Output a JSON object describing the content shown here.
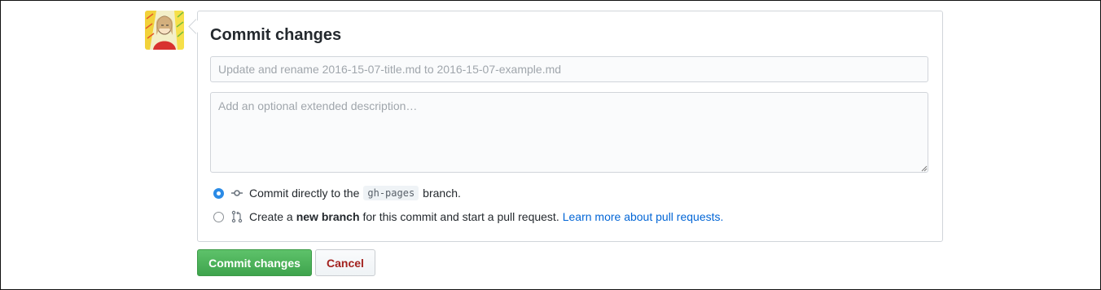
{
  "commit_form": {
    "title": "Commit changes",
    "summary_placeholder": "Update and rename 2016-15-07-title.md to 2016-15-07-example.md",
    "summary_value": "",
    "description_placeholder": "Add an optional extended description…",
    "description_value": "",
    "options": [
      {
        "selected": true,
        "icon": "git-commit-icon",
        "text_before": "Commit directly to the",
        "branch": "gh-pages",
        "text_after": "branch."
      },
      {
        "selected": false,
        "icon": "git-pull-request-icon",
        "text_before": "Create a",
        "bold": "new branch",
        "text_after": "for this commit and start a pull request.",
        "link": "Learn more about pull requests."
      }
    ],
    "buttons": {
      "commit_label": "Commit changes",
      "cancel_label": "Cancel"
    }
  },
  "colors": {
    "accent_blue": "#2b8be6",
    "link_blue": "#0366d6",
    "commit_green": "#3ea44d",
    "cancel_red": "#a3221f"
  }
}
